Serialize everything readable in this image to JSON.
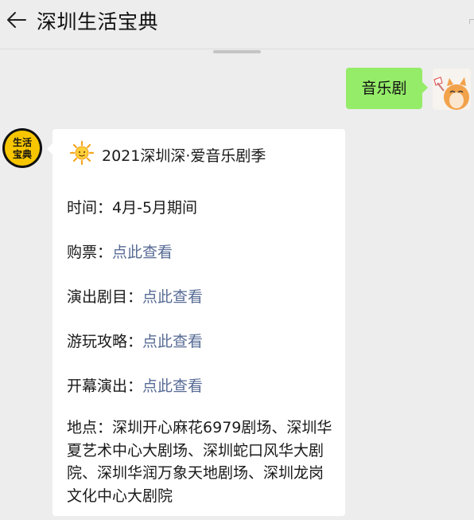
{
  "header": {
    "title": "深圳生活宝典"
  },
  "outgoing": {
    "text": "音乐剧"
  },
  "bot_avatar": {
    "line1": "生活",
    "line2": "宝典"
  },
  "card": {
    "title": "2021深圳深·爱音乐剧季",
    "time_label": "时间：",
    "time_value": "4月-5月期间",
    "tickets_label": "购票：",
    "tickets_link": "点此查看",
    "shows_label": "演出剧目：",
    "shows_link": "点此查看",
    "guide_label": "游玩攻略：",
    "guide_link": "点此查看",
    "opening_label": "开幕演出：",
    "opening_link": "点此查看",
    "address_label": "地点：",
    "address_value": "深圳开心麻花6979剧场、深圳华夏艺术中心大剧场、深圳蛇口风华大剧院、深圳华润万象天地剧场、深圳龙岗文化中心大剧院"
  },
  "colors": {
    "bubble_out": "#95ec69",
    "link": "#576b95",
    "bg": "#ededed"
  }
}
